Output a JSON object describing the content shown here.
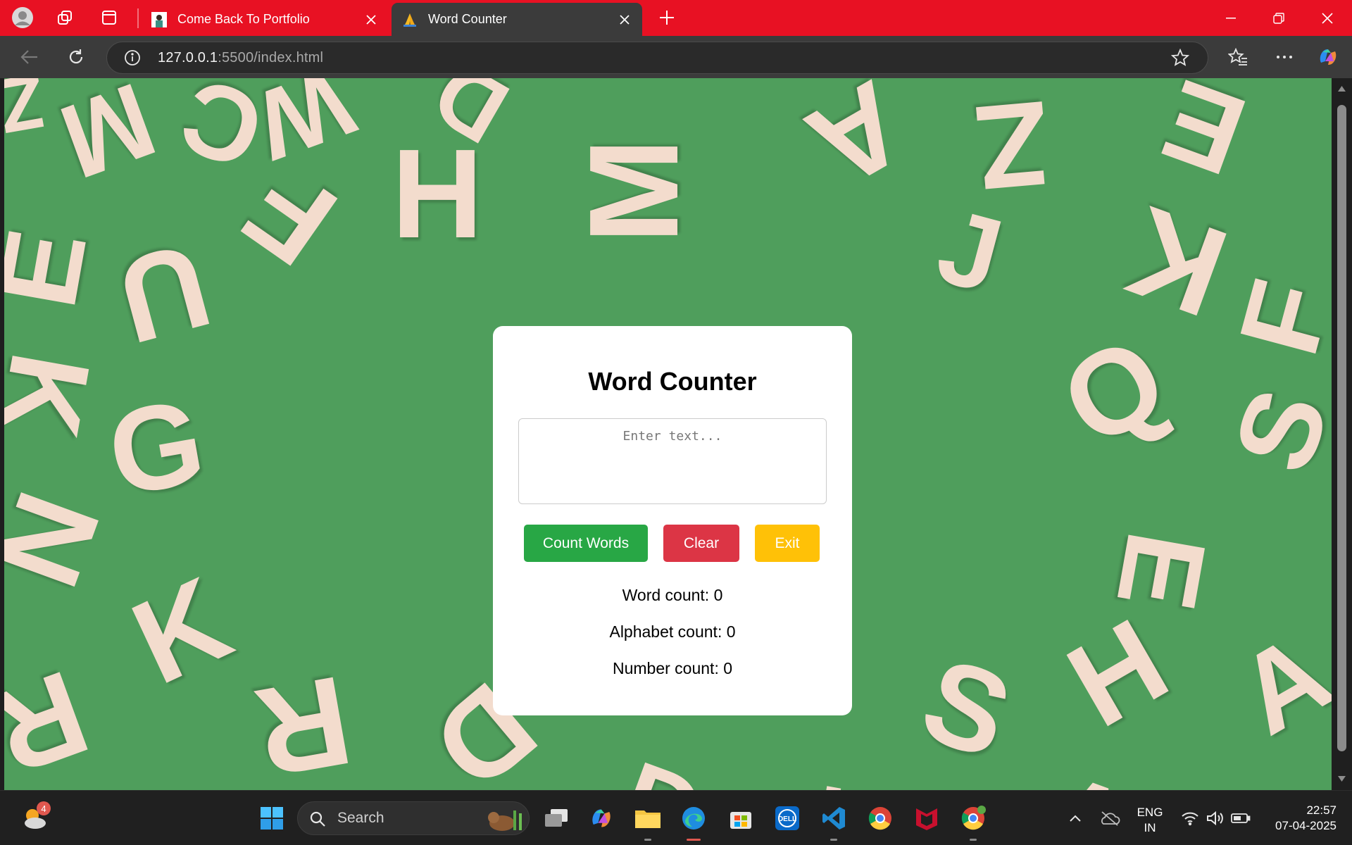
{
  "browser": {
    "tabs": [
      {
        "title": "Come Back To Portfolio",
        "active": false
      },
      {
        "title": "Word Counter",
        "active": true
      }
    ],
    "url_host": "127.0.0.1",
    "url_rest": ":5500/index.html"
  },
  "page": {
    "background_letters": [
      "Z",
      "M",
      "C",
      "W",
      "D",
      "A",
      "Z",
      "E",
      "H",
      "F",
      "M",
      "J",
      "E",
      "U",
      "K",
      "F",
      "K",
      "Q",
      "G",
      "S",
      "N",
      "E",
      "K",
      "R",
      "D",
      "S",
      "H",
      "A",
      "R",
      "D",
      "K",
      "A"
    ]
  },
  "card": {
    "title": "Word Counter",
    "textarea_placeholder": "Enter text...",
    "buttons": {
      "count": "Count Words",
      "clear": "Clear",
      "exit": "Exit"
    },
    "word_count": "Word count: 0",
    "alphabet_count": "Alphabet count: 0",
    "number_count": "Number count: 0"
  },
  "colors": {
    "titlebar": "#e81123",
    "count_button": "#28a745",
    "clear_button": "#dc3545",
    "exit_button": "#ffc107",
    "background_green": "#4f9e5c"
  },
  "taskbar": {
    "weather_badge": "4",
    "search_label": "Search",
    "language": "ENG",
    "region": "IN",
    "time": "22:57",
    "date": "07-04-2025"
  }
}
